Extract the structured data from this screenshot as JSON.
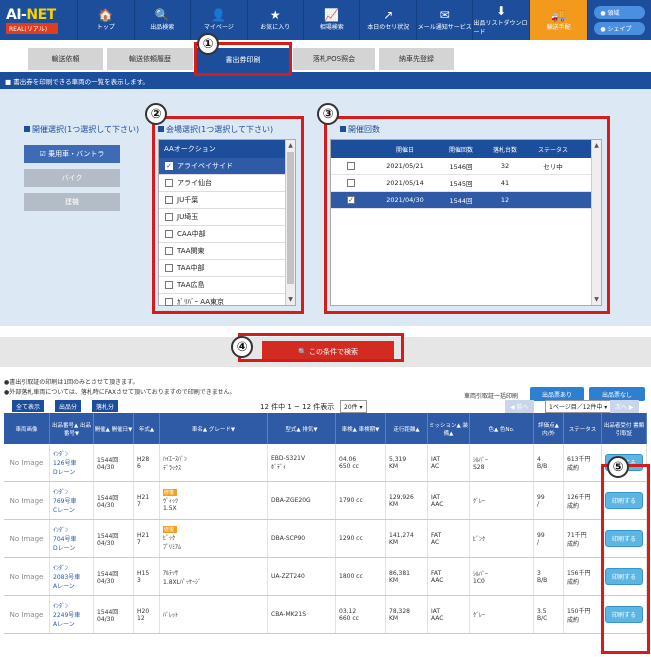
{
  "nav": {
    "logo_text_main": "AI-",
    "logo_text_accent": "NET",
    "logo_sub": "REAL(リアル)",
    "items": [
      {
        "icon": "🏠",
        "label": "トップ"
      },
      {
        "icon": "🔍",
        "label": "出品検索"
      },
      {
        "icon": "👤",
        "label": "マイページ"
      },
      {
        "icon": "★",
        "label": "お気に入り"
      },
      {
        "icon": "📈",
        "label": "相場検索"
      },
      {
        "icon": "↗",
        "label": "本日のセリ状況"
      },
      {
        "icon": "✉",
        "label": "メール通知サービス"
      },
      {
        "icon": "⬇",
        "label": "出品リストダウンロード"
      },
      {
        "icon": "🚚",
        "label": "輸送手配"
      }
    ],
    "right_buttons": [
      "● 領域",
      "● シェイプ"
    ]
  },
  "tabs": [
    "輸送依頼",
    "輸送依頼履歴",
    "書出券印刷",
    "落札POS照会",
    "納車先登録"
  ],
  "active_tab_index": 2,
  "info_text": "■ 書出券を印刷できる車両の一覧を表示します。",
  "selection": {
    "type_title": "開催選択(1つ選択して下さい)",
    "type_buttons": [
      "☑ 乗用車・バントラ",
      "バイク",
      "建機"
    ],
    "venue_title": "会場選択(1つ選択して下さい)",
    "venue_header": "AAオークション",
    "venues": [
      "アライベイサイド",
      "アライ仙台",
      "JU千葉",
      "JU埼玉",
      "CAA中部",
      "TAA関東",
      "TAA中部",
      "TAA広島",
      "ｶﾞﾘﾊﾞｰ AA東京"
    ],
    "selected_venue_index": 0,
    "count_title": "開催回数",
    "count_headers": [
      "",
      "開催日",
      "開催回数",
      "落札台数",
      "ステータス"
    ],
    "count_rows": [
      {
        "date": "2021/05/21",
        "count": "1546回",
        "units": "32",
        "status": "セリ中",
        "checked": false
      },
      {
        "date": "2021/05/14",
        "count": "1545回",
        "units": "41",
        "status": "",
        "checked": false
      },
      {
        "date": "2021/04/30",
        "count": "1544回",
        "units": "12",
        "status": "",
        "checked": true
      }
    ]
  },
  "search_button": "🔍 この条件で検索",
  "notes": [
    "●書出引取証の印刷は1回のみとさせて頂きます。",
    "●外部落札車両については、落札時にFAXさせて頂いておりますので印刷できません。"
  ],
  "bulk_print": {
    "label": "車両引取証一括印刷",
    "buttons": [
      "出品票あり",
      "出品票なし"
    ]
  },
  "list_toolbar": {
    "buttons": [
      "全て表示",
      "出品分",
      "落札分"
    ],
    "summary": "12 件中 1 ~ 12 件表示",
    "per_page": "20件 ▾",
    "pager_prev": "◀ 前へ",
    "page_select": "1ページ目／12件中 ▾",
    "pager_next": "次へ ▶"
  },
  "table_headers": [
    "車両画像",
    "出品番号▲\n出品番号▼",
    "開催▲\n開催日▼",
    "年式▲",
    "車名▲\nグレード▼",
    "型式▲\n排気▼",
    "車検▲\n車検期▼",
    "走行距離▲",
    "ミッション▲\n装備▲",
    "色▲\n色No.",
    "評価点▲\n内/外",
    "ステータス",
    "出品者受付\n書類引取証"
  ],
  "rows": [
    {
      "img": "No Image",
      "lot": [
        "ｲﾝﾀﾞﾝ",
        "126号車",
        "Dレーン"
      ],
      "event": [
        "1544回",
        "04/30"
      ],
      "year": [
        "H28",
        "6"
      ],
      "name": [
        "ﾊｲｴｰｽﾊﾞﾝ",
        "ﾃﾞﾗｯｸｽ"
      ],
      "badge": "",
      "model": [
        "EBD-S321V",
        "ﾎﾞﾃﾞｨ"
      ],
      "shaken": [
        "04.06",
        "650 cc"
      ],
      "km": [
        "5,319",
        "KM"
      ],
      "mission": [
        "IAT",
        "AC"
      ],
      "color": [
        "ｼﾙﾊﾞｰ",
        "S28"
      ],
      "grade": [
        "4",
        "B/B"
      ],
      "status": [
        "613千円",
        "成約"
      ],
      "print": "印刷する"
    },
    {
      "img": "No Image",
      "lot": [
        "ｲﾝﾀﾞﾝ",
        "769号車",
        "Cレーン"
      ],
      "event": [
        "1544回",
        "04/30"
      ],
      "year": [
        "H21",
        "7"
      ],
      "name": [
        "ｳﾞｨｯﾂ",
        "1.5X"
      ],
      "badge": "修復",
      "model": [
        "DBA-ZGE20G",
        ""
      ],
      "shaken": [
        "",
        "1790 cc"
      ],
      "km": [
        "129,926",
        "KM"
      ],
      "mission": [
        "IAT",
        "AAC"
      ],
      "color": [
        "ｸﾞﾚｰ",
        ""
      ],
      "grade": [
        "99",
        "/"
      ],
      "status": [
        "126千円",
        "成約"
      ],
      "print": "印刷する"
    },
    {
      "img": "No Image",
      "lot": [
        "ｲﾝﾀﾞﾝ",
        "704号車",
        "Dレーン"
      ],
      "event": [
        "1544回",
        "04/30"
      ],
      "year": [
        "H21",
        "7"
      ],
      "name": [
        "ﾋﾞｯｸ",
        "ﾌﾟﾘﾐｱﾑ"
      ],
      "badge": "修復",
      "model": [
        "DBA-SCP90",
        ""
      ],
      "shaken": [
        "",
        "1290 cc"
      ],
      "km": [
        "141,274",
        "KM"
      ],
      "mission": [
        "FAT",
        "AC"
      ],
      "color": [
        "ﾋﾟﾝｸ",
        ""
      ],
      "grade": [
        "99",
        "/"
      ],
      "status": [
        "71千円",
        "成約"
      ],
      "print": "印刷する"
    },
    {
      "img": "No Image",
      "lot": [
        "ｲﾝﾀﾞﾝ",
        "2083号車",
        "Aレーン"
      ],
      "event": [
        "1544回",
        "04/30"
      ],
      "year": [
        "H15",
        "3"
      ],
      "name": [
        "ｱﾙﾃｯｻ",
        "1.8XLﾊﾟｯｹｰｼﾞ"
      ],
      "badge": "",
      "model": [
        "UA-ZZT240",
        ""
      ],
      "shaken": [
        "",
        "1800 cc"
      ],
      "km": [
        "86,381",
        "KM"
      ],
      "mission": [
        "FAT",
        "AAC"
      ],
      "color": [
        "ｼﾙﾊﾞｰ",
        "1C0"
      ],
      "grade": [
        "3",
        "B/B"
      ],
      "status": [
        "156千円",
        "成約"
      ],
      "print": "印刷する"
    },
    {
      "img": "No Image",
      "lot": [
        "ｲﾝﾀﾞﾝ",
        "2249号車",
        "Aレーン"
      ],
      "event": [
        "1544回",
        "04/30"
      ],
      "year": [
        "H20",
        "12"
      ],
      "name": [
        "ﾊﾞﾚｯﾄ",
        ""
      ],
      "badge": "",
      "model": [
        "CBA-MK21S",
        ""
      ],
      "shaken": [
        "03.12",
        "660 cc"
      ],
      "km": [
        "78,328",
        "KM"
      ],
      "mission": [
        "IAT",
        "AAC"
      ],
      "color": [
        "ｸﾞﾚｰ",
        ""
      ],
      "grade": [
        "3.5",
        "B/C"
      ],
      "status": [
        "150千円",
        "成約"
      ],
      "print": "印刷する"
    }
  ],
  "callout_numbers": [
    "①",
    "②",
    "③",
    "④",
    "⑤"
  ],
  "colors": {
    "primary": "#1c4e9c",
    "accent_red": "#d41c1c",
    "orange": "#f39a1c",
    "panel": "#dce8f3"
  }
}
